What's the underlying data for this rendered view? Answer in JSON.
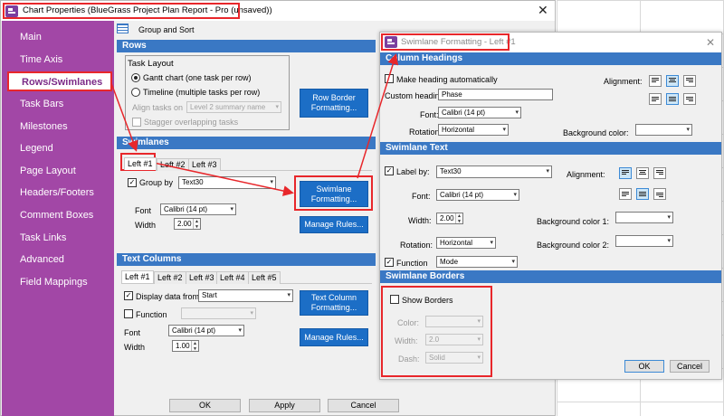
{
  "main": {
    "title": "Chart Properties (BlueGrass Project Plan Report - Pro (unsaved))",
    "icons": {
      "app": "app-icon",
      "close": "close-icon"
    },
    "close_glyph": "✕",
    "sidebar": {
      "items": [
        {
          "label": "Main"
        },
        {
          "label": "Time Axis"
        },
        {
          "label": "Rows/Swimlanes"
        },
        {
          "label": "Task Bars"
        },
        {
          "label": "Milestones"
        },
        {
          "label": "Legend"
        },
        {
          "label": "Page Layout"
        },
        {
          "label": "Headers/Footers"
        },
        {
          "label": "Comment Boxes"
        },
        {
          "label": "Task Links"
        },
        {
          "label": "Advanced"
        },
        {
          "label": "Field Mappings"
        }
      ],
      "active_index": 2
    },
    "group_sort_label": "Group and Sort",
    "rows": {
      "header": "Rows",
      "task_layout_label": "Task Layout",
      "gantt_label": "Gantt chart (one task per row)",
      "timeline_label": "Timeline (multiple tasks per row)",
      "align_label": "Align tasks on",
      "align_value": "Level 2 summary name",
      "stagger_label": "Stagger overlapping tasks",
      "row_border_button": "Row Border\nFormatting..."
    },
    "swimlanes": {
      "header": "Swimlanes",
      "tabs": [
        "Left #1",
        "Left #2",
        "Left #3"
      ],
      "group_by_label": "Group by",
      "group_by_value": "Text30",
      "group_by_checked": true,
      "font_label": "Font",
      "font_value": "Calibri (14 pt)",
      "width_label": "Width",
      "width_value": "2.00",
      "formatting_button": "Swimlane\nFormatting...",
      "manage_rules_button": "Manage Rules..."
    },
    "text_columns": {
      "header": "Text Columns",
      "tabs": [
        "Left #1",
        "Left #2",
        "Left #3",
        "Left #4",
        "Left #5"
      ],
      "display_label": "Display data from",
      "display_value": "Start",
      "display_checked": true,
      "function_label": "Function",
      "font_label": "Font",
      "font_value": "Calibri (14 pt)",
      "width_label": "Width",
      "width_value": "1.00",
      "formatting_button": "Text Column\nFormatting...",
      "manage_rules_button": "Manage Rules..."
    },
    "buttons": {
      "ok": "OK",
      "apply": "Apply",
      "cancel": "Cancel"
    }
  },
  "dialog": {
    "title": "Swimlane Formatting - Left #1",
    "close_glyph": "✕",
    "column_headings": {
      "header": "Column Headings",
      "make_auto_label": "Make heading automatically",
      "custom_heading_label": "Custom heading:",
      "custom_heading_value": "Phase",
      "font_label": "Font:",
      "font_value": "Calibri (14 pt)",
      "rotation_label": "Rotation:",
      "rotation_value": "Horizontal",
      "alignment_label": "Alignment:",
      "bg_label": "Background color:"
    },
    "swimlane_text": {
      "header": "Swimlane Text",
      "label_by_label": "Label by:",
      "label_by_value": "Text30",
      "font_label": "Font:",
      "font_value": "Calibri (14 pt)",
      "width_label": "Width:",
      "width_value": "2.00",
      "rotation_label": "Rotation:",
      "rotation_value": "Horizontal",
      "function_label": "Function",
      "function_value": "Mode",
      "alignment_label": "Alignment:",
      "bg1_label": "Background color 1:",
      "bg2_label": "Background color 2:"
    },
    "swimlane_borders": {
      "header": "Swimlane Borders",
      "show_borders_label": "Show Borders",
      "color_label": "Color:",
      "width_label": "Width:",
      "width_value": "2.0",
      "dash_label": "Dash:",
      "dash_value": "Solid"
    },
    "buttons": {
      "ok": "OK",
      "cancel": "Cancel"
    }
  },
  "colors": {
    "accent": "#1c6ec6",
    "sidebar": "#a247a6",
    "highlight": "#e8272b",
    "section": "#3a78c4"
  }
}
